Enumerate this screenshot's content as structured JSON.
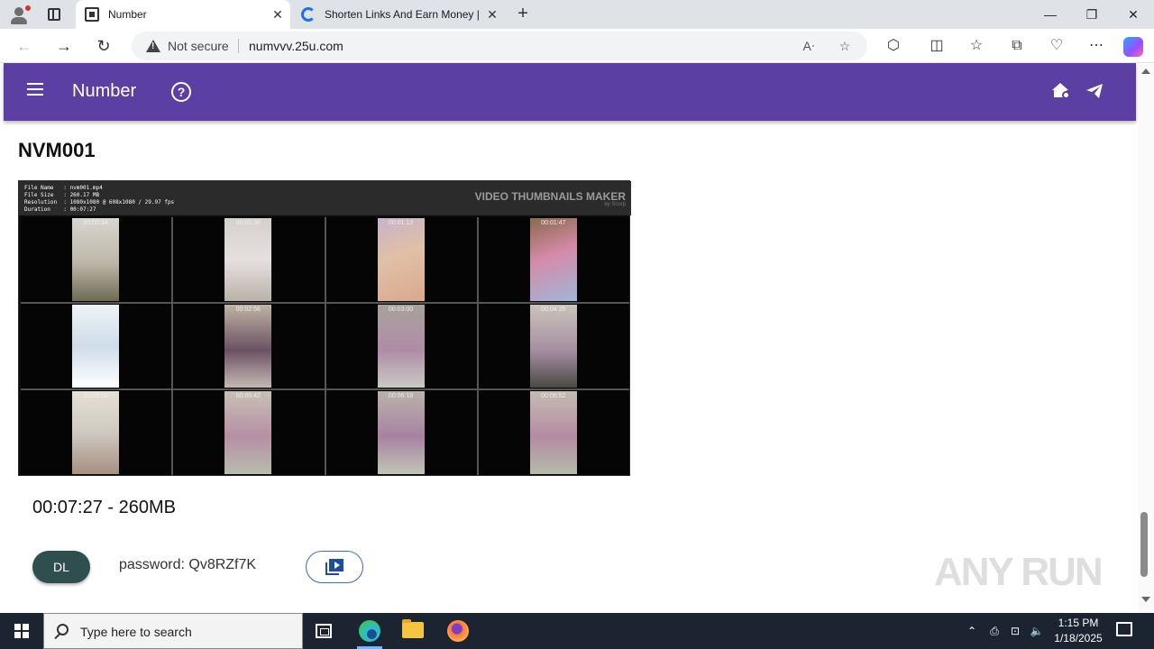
{
  "browser": {
    "tabs": [
      {
        "title": "Number",
        "active": true
      },
      {
        "title": "Shorten Links And Earn Money |",
        "active": false
      }
    ],
    "address": {
      "security_label": "Not secure",
      "url": "numvvv.25u.com"
    }
  },
  "app": {
    "title": "Number",
    "accent_color": "#5b3fa3"
  },
  "content": {
    "video_title": "NVM001",
    "thumb_sheet": {
      "meta_lines": "File Name   : nvm001.mp4\nFile Size   : 260.17 MB\nResolution  : 1080x1080 @ 608x1080 / 29.97 fps\nDuration    : 00:07:27",
      "maker": "VIDEO THUMBNAILS MAKER",
      "maker_sub": "by Scorp",
      "timestamps": [
        "00:00:34",
        "00:00:38",
        "00:01:13",
        "00:01:47",
        "00:02:22",
        "00:02:56",
        "00:03:00",
        "00:04:35",
        "00:05:08",
        "00:05:42",
        "00:06:18",
        "00:06:52"
      ]
    },
    "duration_size": "00:07:27 - 260MB",
    "dl_label": "DL",
    "password_text": "password: Qv8RZf7K",
    "watermark": "ANY RUN"
  },
  "taskbar": {
    "search_placeholder": "Type here to search",
    "time": "1:15 PM",
    "date": "1/18/2025"
  }
}
